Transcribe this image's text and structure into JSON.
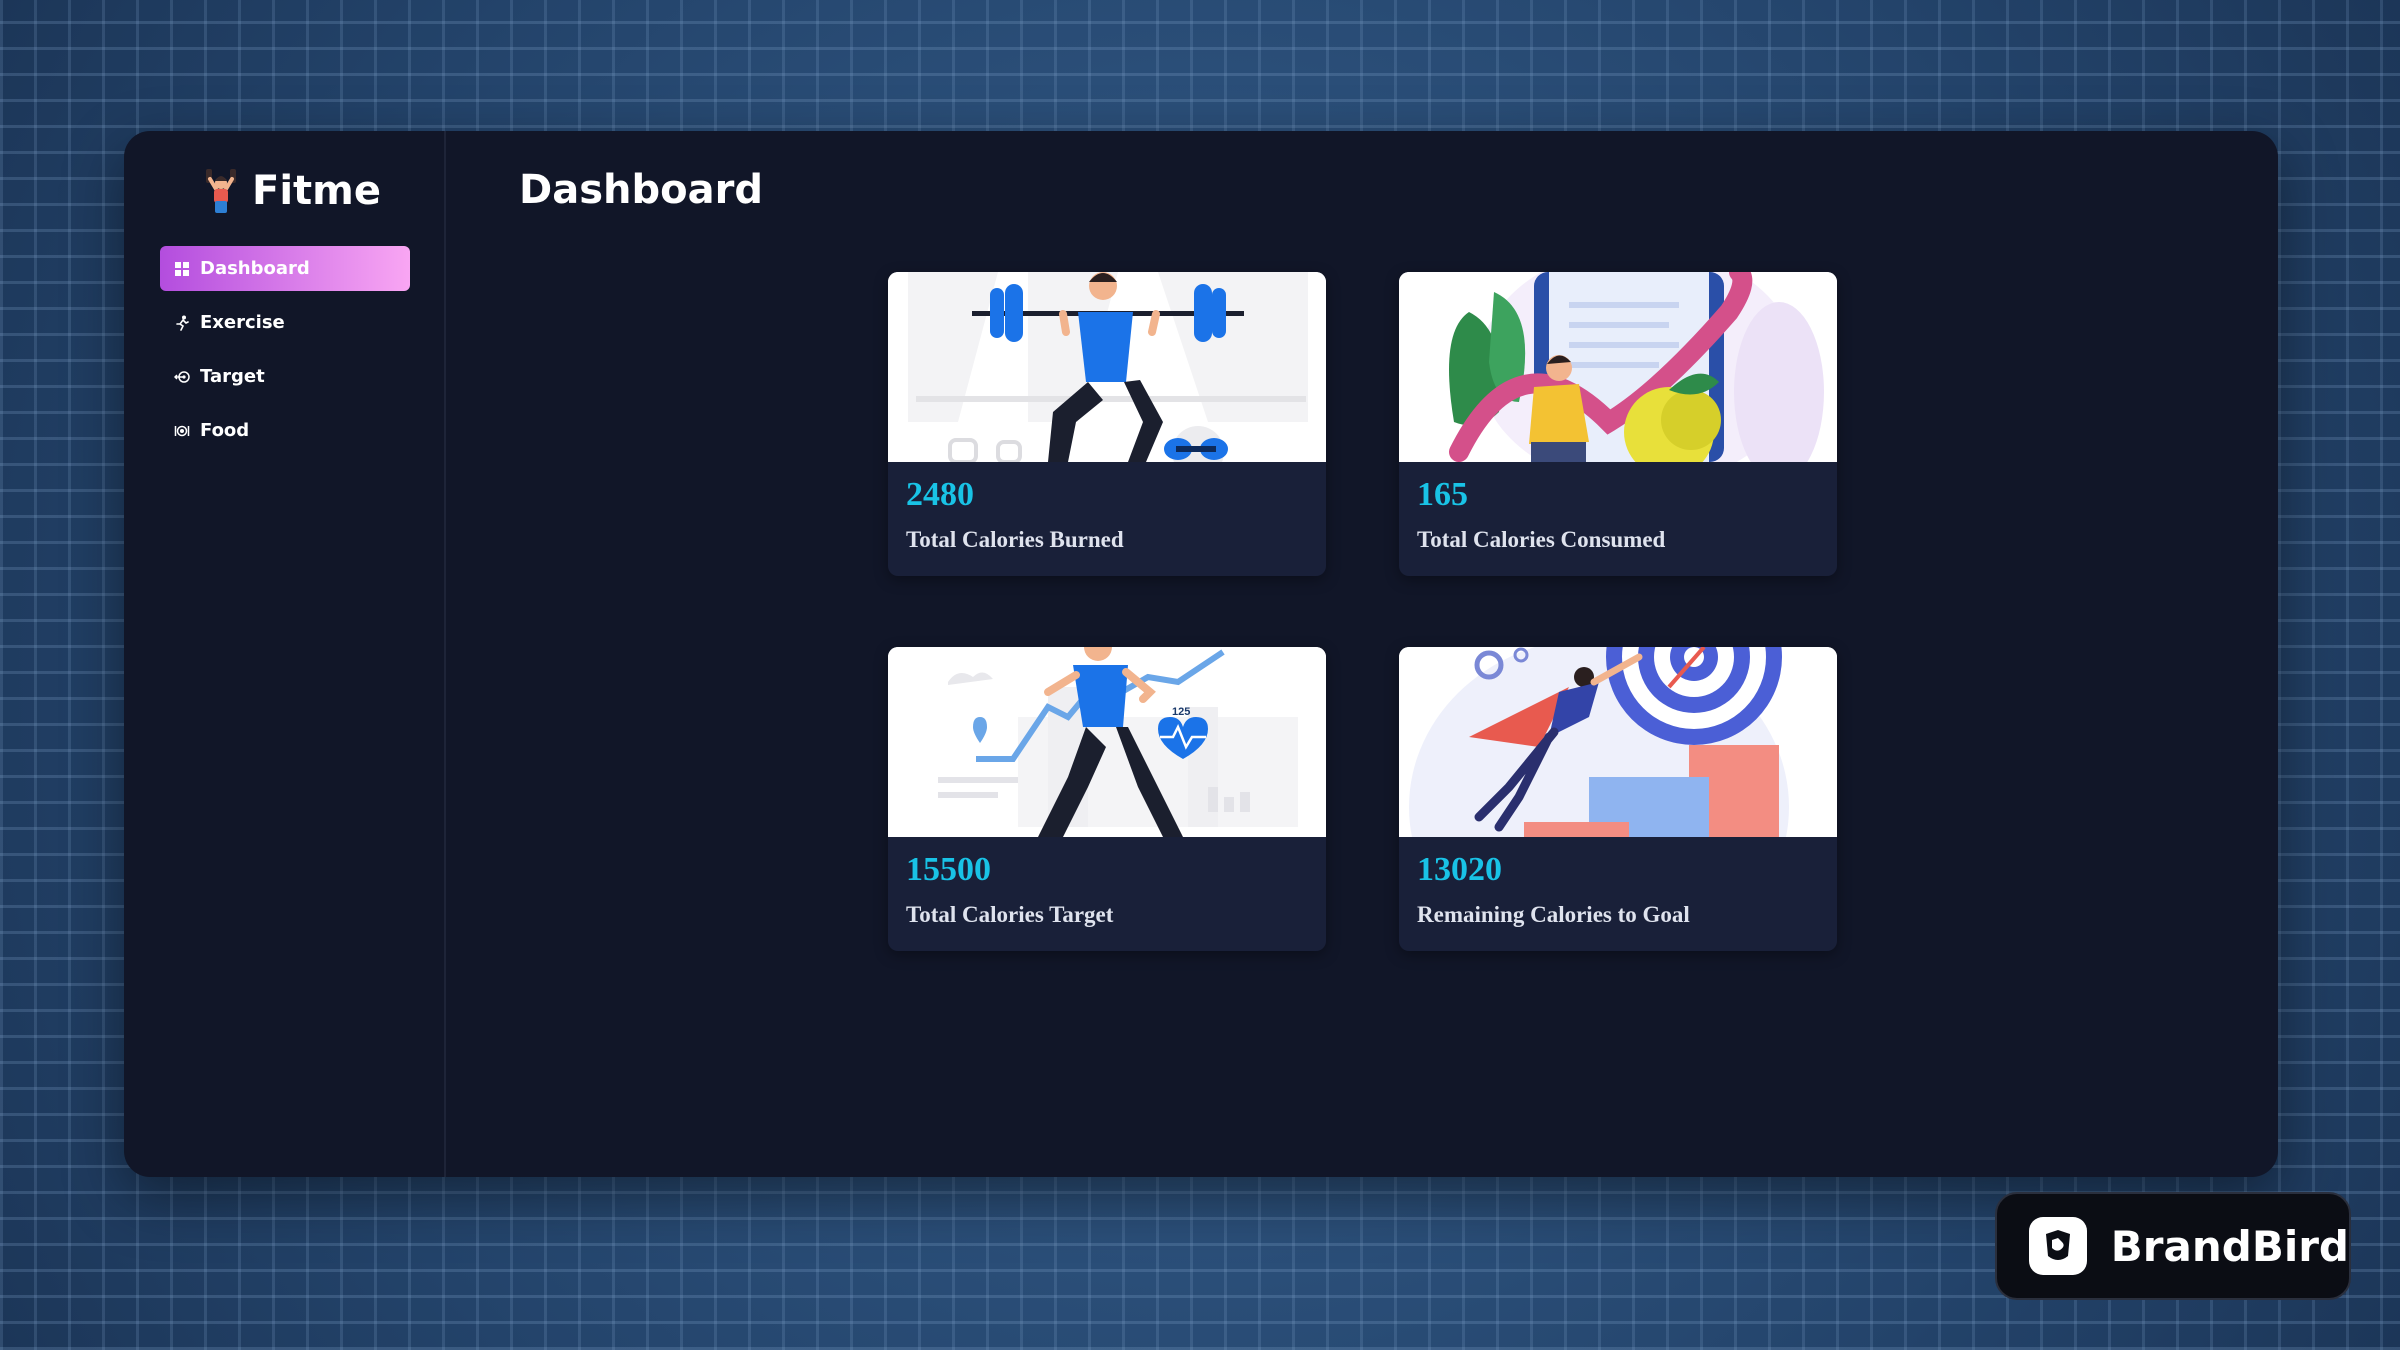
{
  "app": {
    "name": "Fitme",
    "logo_icon": "person-weightlifting-icon"
  },
  "sidebar": {
    "items": [
      {
        "label": "Dashboard",
        "icon": "dashboard-grid-icon",
        "active": true
      },
      {
        "label": "Exercise",
        "icon": "running-person-icon",
        "active": false
      },
      {
        "label": "Target",
        "icon": "target-arrow-icon",
        "active": false
      },
      {
        "label": "Food",
        "icon": "food-plate-icon",
        "active": false
      }
    ]
  },
  "main": {
    "title": "Dashboard",
    "cards": [
      {
        "value": "2480",
        "label": "Total Calories Burned",
        "illustration": "weightlifter-illustration"
      },
      {
        "value": "165",
        "label": "Total Calories Consumed",
        "illustration": "nutrition-apple-illustration"
      },
      {
        "value": "15500",
        "label": "Total Calories Target",
        "illustration": "runner-heart-rate-illustration"
      },
      {
        "value": "13020",
        "label": "Remaining Calories to Goal",
        "illustration": "goal-target-hero-illustration"
      }
    ]
  },
  "watermark": {
    "label": "BrandBird",
    "icon": "brandbird-logo-icon"
  },
  "colors": {
    "accent_gradient_start": "#b34dde",
    "accent_gradient_end": "#f9a6f3",
    "stat_value": "#19c3e6",
    "panel_bg": "#111628",
    "card_bg": "#192039"
  }
}
